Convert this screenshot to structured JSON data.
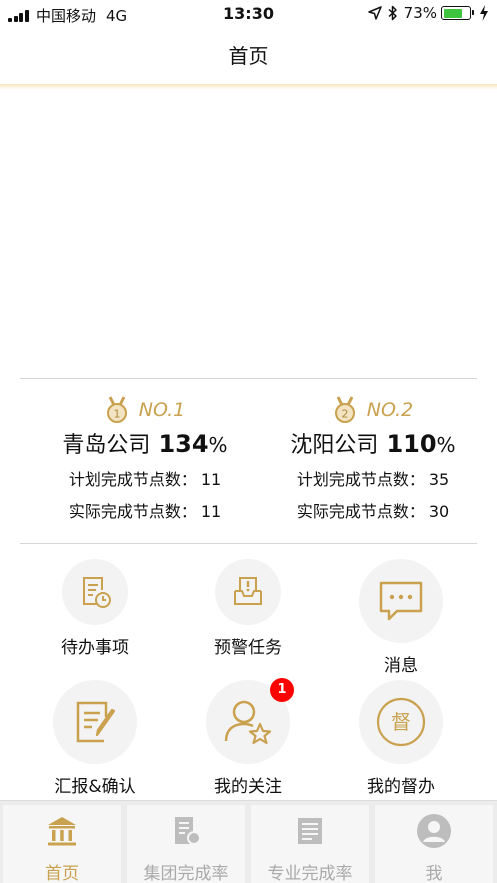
{
  "status_bar": {
    "carrier": "中国移动",
    "network": "4G",
    "time": "13:30",
    "battery_text": "73%",
    "battery_level": 0.73,
    "icons": [
      "signal-icon",
      "location-arrow-icon",
      "bluetooth-icon",
      "battery-icon",
      "charging-bolt-icon"
    ]
  },
  "nav": {
    "title": "首页"
  },
  "ranking": [
    {
      "rank_label": "NO.1",
      "medal_number": "1",
      "company": "青岛公司",
      "percent": "134",
      "percent_sign": "%",
      "planned_label": "计划完成节点数：",
      "planned_value": "11",
      "actual_label": "实际完成节点数：",
      "actual_value": "11"
    },
    {
      "rank_label": "NO.2",
      "medal_number": "2",
      "company": "沈阳公司",
      "percent": "110",
      "percent_sign": "%",
      "planned_label": "计划完成节点数：",
      "planned_value": "35",
      "actual_label": "实际完成节点数：",
      "actual_value": "30"
    }
  ],
  "grid": [
    {
      "label": "待办事项",
      "icon": "todo-document-clock-icon"
    },
    {
      "label": "预警任务",
      "icon": "warning-tray-icon"
    },
    {
      "label": "消息",
      "icon": "message-bubble-icon"
    },
    {
      "label": "汇报&确认",
      "icon": "report-edit-icon"
    },
    {
      "label": "我的关注",
      "icon": "user-star-icon",
      "badge": "1"
    },
    {
      "label": "我的督办",
      "icon": "supervise-seal-icon",
      "seal_char": "督"
    }
  ],
  "tabs": [
    {
      "label": "首页",
      "icon": "bank-building-icon",
      "active": true
    },
    {
      "label": "集团完成率",
      "icon": "group-certificate-icon",
      "active": false
    },
    {
      "label": "专业完成率",
      "icon": "professional-list-icon",
      "active": false
    },
    {
      "label": "我",
      "icon": "user-profile-icon",
      "active": false
    }
  ],
  "colors": {
    "accent": "#c9a14f",
    "badge": "#ff0000",
    "battery": "#3ec43e",
    "tab_inactive": "#aaaaaa"
  }
}
